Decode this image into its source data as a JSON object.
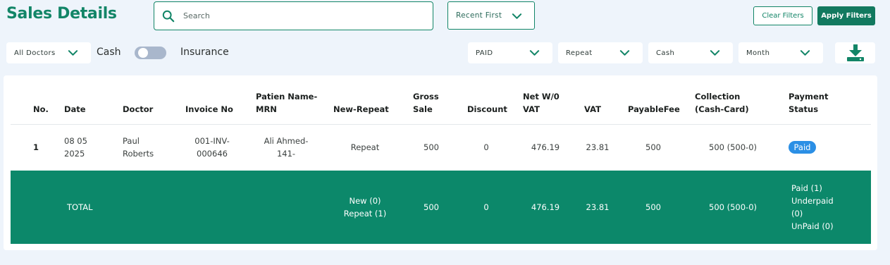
{
  "page": {
    "title": "Sales Details"
  },
  "search": {
    "placeholder": "Search"
  },
  "sort": {
    "value": "Recent First"
  },
  "buttons": {
    "clear": "Clear Filters",
    "apply": "Apply Filters"
  },
  "filters": {
    "doctor": "All Doctors",
    "cash_label": "Cash",
    "insurance_toggle_on": false,
    "insurance_label": "Insurance",
    "payment_status": "PAID",
    "visit_type": "Repeat",
    "payment_method": "Cash",
    "period": "Month"
  },
  "icons": {
    "search": "search-icon",
    "chevron": "chevron-down-icon",
    "download": "download-icon"
  },
  "colors": {
    "brand": "#128567",
    "total_row": "#0c886a",
    "paid_badge": "#2b8fe5"
  },
  "table": {
    "headers": {
      "no": "No.",
      "date": "Date",
      "doctor": "Doctor",
      "invoice": "Invoice No",
      "patient_1": "Patien Name-",
      "patient_2": "MRN",
      "new_repeat": "New-Repeat",
      "gross_1": "Gross",
      "gross_2": "Sale",
      "discount": "Discount",
      "net_1": "Net W/0",
      "net_2": "VAT",
      "vat": "VAT",
      "payable": "PayableFee",
      "collection_1": "Collection",
      "collection_2": "(Cash-Card)",
      "status_1": "Payment",
      "status_2": "Status"
    },
    "rows": [
      {
        "no": "1",
        "date_1": "08 05",
        "date_2": "2025",
        "doctor_1": "Paul",
        "doctor_2": "Roberts",
        "invoice_1": "001-INV-",
        "invoice_2": "000646",
        "patient_1": "Ali Ahmed-",
        "patient_2": "141-",
        "new_repeat": "Repeat",
        "gross": "500",
        "discount": "0",
        "net": "476.19",
        "vat": "23.81",
        "payable": "500",
        "collection": "500 (500-0)",
        "status": "Paid"
      }
    ],
    "total": {
      "label": "TOTAL",
      "new": "New (0)",
      "repeat": "Repeat (1)",
      "gross": "500",
      "discount": "0",
      "net": "476.19",
      "vat": "23.81",
      "payable": "500",
      "collection": "500 (500-0)",
      "paid": "Paid (1)",
      "underpaid_1": "Underpaid",
      "underpaid_2": "(0)",
      "unpaid": "UnPaid (0)"
    }
  }
}
